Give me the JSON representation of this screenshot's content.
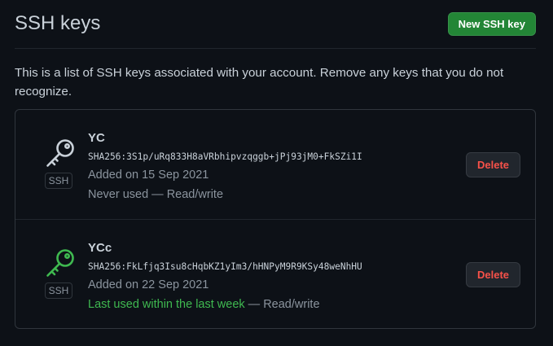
{
  "header": {
    "title": "SSH keys",
    "new_key_label": "New SSH key"
  },
  "intro": "This is a list of SSH keys associated with your account. Remove any keys that you do not recognize.",
  "keys": [
    {
      "name": "YC",
      "fingerprint": "SHA256:3S1p/uRq833H8aVRbhipvzqggb+jPj93jM0+FkSZi1I",
      "added": "Added on 15 Sep 2021",
      "usage_highlight": "",
      "usage_text": "Never used — Read/write",
      "type_label": "SSH",
      "icon": "key-icon",
      "icon_color": "#c9d1d9",
      "delete_label": "Delete"
    },
    {
      "name": "YCc",
      "fingerprint": "SHA256:FkLfjq3Isu8cHqbKZ1yIm3/hHNPyM9R9KSy48weNhHU",
      "added": "Added on 22 Sep 2021",
      "usage_highlight": "Last used within the last week",
      "usage_text": " — Read/write",
      "type_label": "SSH",
      "icon": "key-icon",
      "icon_color": "#3fb950",
      "delete_label": "Delete"
    }
  ],
  "colors": {
    "background": "#0d1117",
    "primary_button": "#238636",
    "danger_text": "#f85149",
    "recent_use": "#3fb950"
  }
}
